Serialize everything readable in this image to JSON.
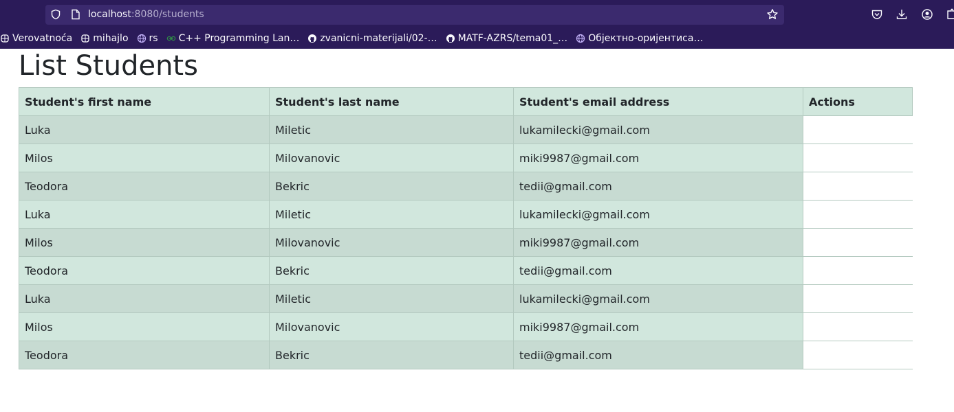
{
  "browser": {
    "url_host": "localhost",
    "url_path": ":8080/students",
    "bookmarks": [
      {
        "label": "Verovatnoća",
        "icon": "generic-site-icon"
      },
      {
        "label": "mihajlo",
        "icon": "generic-site-icon"
      },
      {
        "label": "rs",
        "icon": "globe-icon"
      },
      {
        "label": "C++ Programming Lan…",
        "icon": "geeksforgeeks-icon"
      },
      {
        "label": "zvanicni-materijali/02-…",
        "icon": "github-icon"
      },
      {
        "label": "MATF-AZRS/tema01_…",
        "icon": "github-icon"
      },
      {
        "label": "Објектно-оријентиса…",
        "icon": "globe-icon"
      }
    ]
  },
  "page": {
    "title": "List Students"
  },
  "table": {
    "headers": {
      "first_name": "Student's first name",
      "last_name": "Student's last name",
      "email": "Student's email address",
      "actions": "Actions"
    },
    "rows": [
      {
        "first": "Luka",
        "last": "Miletic",
        "email": "lukamilecki@gmail.com"
      },
      {
        "first": "Milos",
        "last": "Milovanovic",
        "email": "miki9987@gmail.com"
      },
      {
        "first": "Teodora",
        "last": "Bekric",
        "email": "tedii@gmail.com"
      },
      {
        "first": "Luka",
        "last": "Miletic",
        "email": "lukamilecki@gmail.com"
      },
      {
        "first": "Milos",
        "last": "Milovanovic",
        "email": "miki9987@gmail.com"
      },
      {
        "first": "Teodora",
        "last": "Bekric",
        "email": "tedii@gmail.com"
      },
      {
        "first": "Luka",
        "last": "Miletic",
        "email": "lukamilecki@gmail.com"
      },
      {
        "first": "Milos",
        "last": "Milovanovic",
        "email": "miki9987@gmail.com"
      },
      {
        "first": "Teodora",
        "last": "Bekric",
        "email": "tedii@gmail.com"
      }
    ]
  },
  "colors": {
    "chrome_bg": "#2b1b59",
    "header_bg": "#d1e7dd",
    "row_dark": "#c7dbd2"
  }
}
